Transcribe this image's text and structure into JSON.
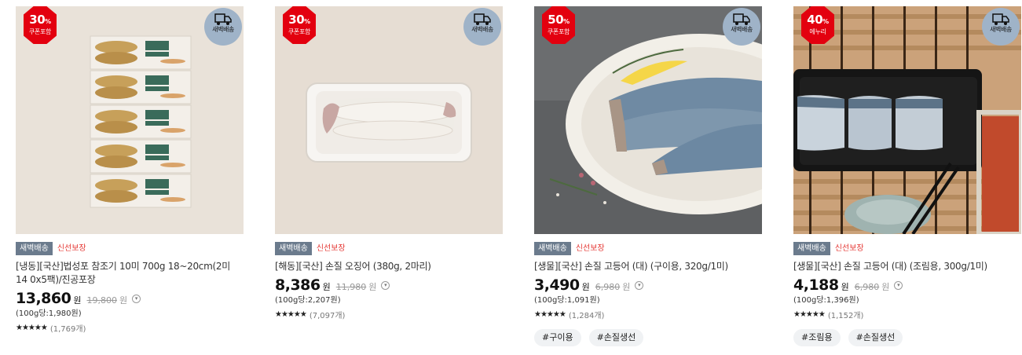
{
  "products": [
    {
      "discount": "30",
      "discount_unit": "%",
      "discount_label": "쿠폰포함",
      "discount_color": "#e3000f",
      "dawn_label": "새벽배송",
      "badge_delivery": "새벽배송",
      "badge_fresh": "신선보장",
      "name": "[냉동][국산]법성포 참조기 10미 700g 18~20cm(2미 14 0x5팩)/진공포장",
      "price": "13,860",
      "price_unit": "원",
      "original_price": "19,800",
      "original_unit": "원",
      "unit_price": "(100g당:1,980원)",
      "stars": "★★★★★",
      "review_count": "(1,769개)",
      "tags": []
    },
    {
      "discount": "30",
      "discount_unit": "%",
      "discount_label": "쿠폰포함",
      "discount_color": "#e3000f",
      "dawn_label": "새벽배송",
      "badge_delivery": "새벽배송",
      "badge_fresh": "신선보장",
      "name": "[해동][국산] 손질 오징어 (380g, 2마리)",
      "price": "8,386",
      "price_unit": "원",
      "original_price": "11,980",
      "original_unit": "원",
      "unit_price": "(100g당:2,207원)",
      "stars": "★★★★★",
      "review_count": "(7,097개)",
      "tags": []
    },
    {
      "discount": "50",
      "discount_unit": "%",
      "discount_label": "쿠폰포함",
      "discount_color": "#e3000f",
      "dawn_label": "새벽배송",
      "badge_delivery": "새벽배송",
      "badge_fresh": "신선보장",
      "name": "[생물][국산] 손질 고등어 (대) (구이용, 320g/1미)",
      "price": "3,490",
      "price_unit": "원",
      "original_price": "6,980",
      "original_unit": "원",
      "unit_price": "(100g당:1,091원)",
      "stars": "★★★★★",
      "review_count": "(1,284개)",
      "tags": [
        "#구이용",
        "#손질생선"
      ]
    },
    {
      "discount": "40",
      "discount_unit": "%",
      "discount_label": "에누리",
      "discount_color": "#e3000f",
      "dawn_label": "새벽배송",
      "badge_delivery": "새벽배송",
      "badge_fresh": "신선보장",
      "name": "[생물][국산] 손질 고등어 (대) (조림용, 300g/1미)",
      "price": "4,188",
      "price_unit": "원",
      "original_price": "6,980",
      "original_unit": "원",
      "unit_price": "(100g당:1,396원)",
      "stars": "★★★★★",
      "review_count": "(1,152개)",
      "tags": [
        "#조림용",
        "#손질생선"
      ]
    }
  ]
}
